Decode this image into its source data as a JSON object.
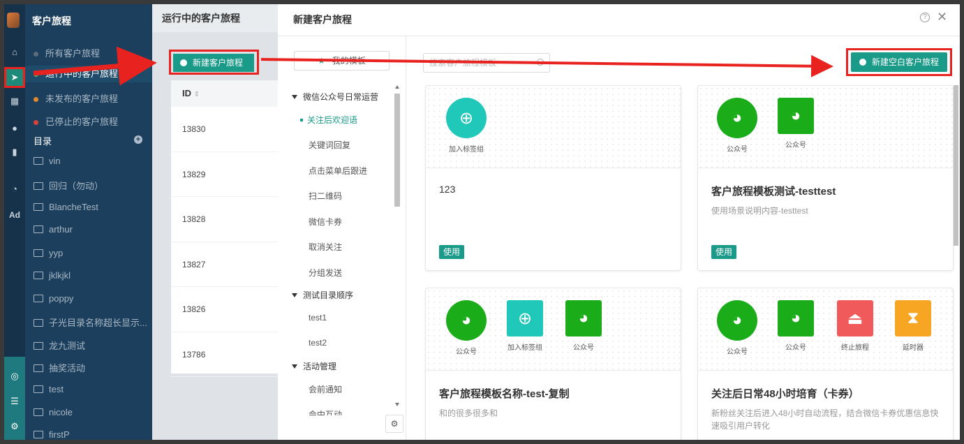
{
  "sidebar": {
    "title": "客户旅程",
    "statuses": [
      {
        "label": "所有客户旅程",
        "color": "#5b6b7a"
      },
      {
        "label": "运行中的客户旅程",
        "color": "#3cc06a"
      },
      {
        "label": "未发布的客户旅程",
        "color": "#e28a2b"
      },
      {
        "label": "已停止的客户旅程",
        "color": "#d9423c"
      }
    ],
    "dir_label": "目录",
    "folders": [
      "vin",
      "回归（勿动）",
      "BlancheTest",
      "arthur",
      "yyp",
      "jklkjkl",
      "poppy",
      "子光目录名称超长显示...",
      "龙九测试",
      "抽奖活动",
      "test",
      "nicole",
      "firstP"
    ]
  },
  "main": {
    "title": "运行中的客户旅程",
    "new_button": "新建客户旅程",
    "id_header": "ID",
    "ids": [
      "13830",
      "13829",
      "13828",
      "13827",
      "13826",
      "13786"
    ]
  },
  "modal": {
    "title": "新建客户旅程",
    "help": "?",
    "close": "✕",
    "my_templates": "我的模板",
    "search_placeholder": "搜索客户旅程模板",
    "new_blank": "新建空白客户旅程",
    "tree": {
      "g1": "微信公众号日常运营",
      "g1_items": [
        "关注后欢迎语",
        "关键词回复",
        "点击菜单后跟进",
        "扫二维码",
        "微信卡券",
        "取消关注",
        "分组发送"
      ],
      "g2": "测试目录顺序",
      "g2_items": [
        "test1",
        "test2"
      ],
      "g3": "活动管理",
      "g3_items": [
        "会前通知",
        "会中互动"
      ]
    },
    "cards": [
      {
        "nodes": [
          "加入标签组"
        ],
        "title": "123",
        "desc": "",
        "use": "使用"
      },
      {
        "nodes": [
          "公众号",
          "公众号"
        ],
        "title": "客户旅程模板测试-testtest",
        "desc": "使用场景说明内容-testtest",
        "use": "使用"
      },
      {
        "nodes": [
          "公众号",
          "加入标签组",
          "公众号"
        ],
        "title": "客户旅程模板名称-test-复制",
        "desc": "和的很多很多和"
      },
      {
        "nodes": [
          "公众号",
          "公众号",
          "终止旅程",
          "延时器"
        ],
        "title": "关注后日常48小时培育（卡券）",
        "desc": "新粉丝关注后进入48小时自动流程，结合微信卡券优惠信息快速吸引用户转化"
      }
    ]
  },
  "colors": {
    "accent": "#1a9a88",
    "wechat": "#1aad19",
    "tag": "#1fc8b8",
    "stop": "#f05a5a",
    "timer": "#f7a623",
    "annotation": "#e8231f"
  }
}
